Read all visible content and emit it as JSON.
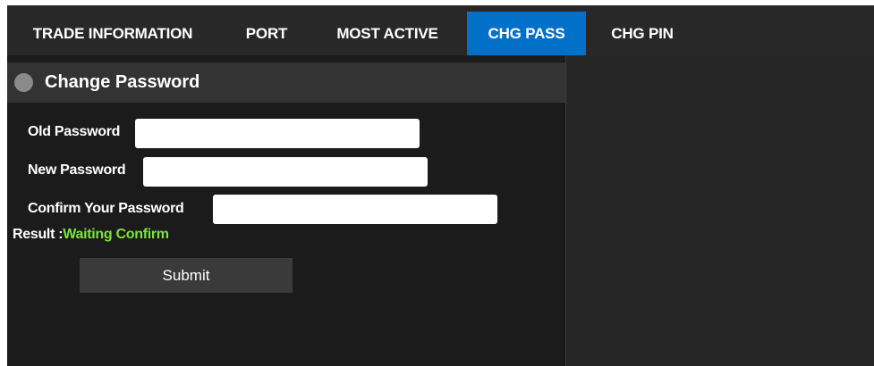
{
  "tabs": [
    {
      "label": "TRADE INFORMATION",
      "active": false
    },
    {
      "label": "PORT",
      "active": false
    },
    {
      "label": "MOST ACTIVE",
      "active": false
    },
    {
      "label": "CHG PASS",
      "active": true
    },
    {
      "label": "CHG PIN",
      "active": false
    }
  ],
  "panel": {
    "title": "Change Password",
    "icon": "circle-icon"
  },
  "form": {
    "old_password": {
      "label": "Old Password",
      "value": ""
    },
    "new_password": {
      "label": "New Password",
      "value": ""
    },
    "confirm_password": {
      "label": "Confirm Your Password",
      "value": ""
    },
    "result_label": "Result :",
    "result_value": "Waiting Confirm",
    "submit_label": "Submit"
  },
  "colors": {
    "active_tab": "#0070c9",
    "result_status": "#7ee23a",
    "background": "#1b1b1b"
  }
}
